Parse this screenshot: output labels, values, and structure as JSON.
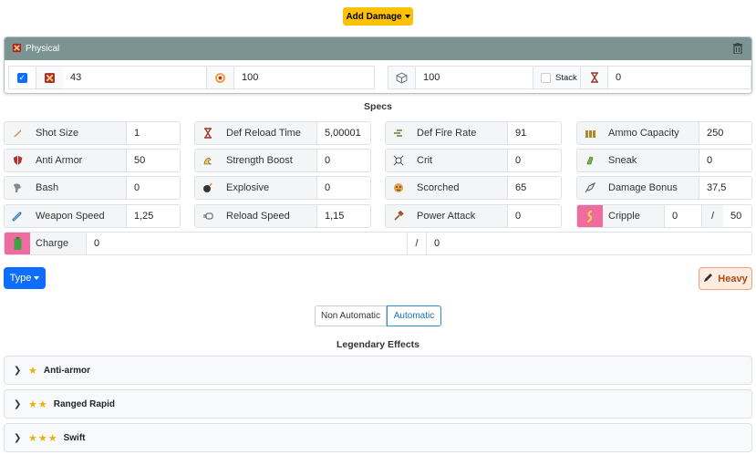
{
  "toolbar": {
    "add_damage_label": "Add Damage"
  },
  "damage_card": {
    "title": "Physical",
    "enabled": true,
    "damage_value": "43",
    "accuracy_value": "100",
    "percent_value": "100",
    "stack_label": "Stack",
    "stack_checked": false,
    "duration_value": "0"
  },
  "specs": {
    "title": "Specs",
    "stats": [
      {
        "label": "Shot Size",
        "value": "1",
        "icon": "bullet-icon"
      },
      {
        "label": "Def Reload Time",
        "value": "5,00001",
        "icon": "hourglass-icon"
      },
      {
        "label": "Def Fire Rate",
        "value": "91",
        "icon": "fire-rate-icon"
      },
      {
        "label": "Ammo Capacity",
        "value": "250",
        "icon": "ammo-icon"
      },
      {
        "label": "Anti Armor",
        "value": "50",
        "icon": "shield-icon"
      },
      {
        "label": "Strength Boost",
        "value": "0",
        "icon": "flex-arm-icon"
      },
      {
        "label": "Crit",
        "value": "0",
        "icon": "crit-icon"
      },
      {
        "label": "Sneak",
        "value": "0",
        "icon": "sneak-icon"
      },
      {
        "label": "Bash",
        "value": "0",
        "icon": "bash-icon"
      },
      {
        "label": "Explosive",
        "value": "0",
        "icon": "bomb-icon"
      },
      {
        "label": "Scorched",
        "value": "65",
        "icon": "scorched-icon"
      },
      {
        "label": "Damage Bonus",
        "value": "37,5",
        "icon": "rocket-icon"
      },
      {
        "label": "Weapon Speed",
        "value": "1,25",
        "icon": "speed-icon"
      },
      {
        "label": "Reload Speed",
        "value": "1,15",
        "icon": "reload-icon"
      },
      {
        "label": "Power Attack",
        "value": "0",
        "icon": "power-attack-icon"
      }
    ],
    "cripple": {
      "label": "Cripple",
      "value": "0",
      "max": "50",
      "icon": "cripple-icon"
    },
    "charge": {
      "label": "Charge",
      "value": "0",
      "max": "0",
      "icon": "battery-icon"
    },
    "slash": "/"
  },
  "type_button": {
    "label": "Type"
  },
  "heavy_button": {
    "label": "Heavy"
  },
  "fire_mode": {
    "options": [
      "Non Automatic",
      "Automatic"
    ],
    "selected": "Automatic"
  },
  "legendary": {
    "title": "Legendary Effects",
    "items": [
      {
        "name": "Anti-armor",
        "stars": 1
      },
      {
        "name": "Ranged Rapid",
        "stars": 2
      },
      {
        "name": "Swift",
        "stars": 3
      }
    ]
  },
  "colors": {
    "accent_blue": "#0d6efd",
    "warning_yellow": "#ffc107",
    "header_gray": "#7c9393",
    "pink": "#f06ba0"
  }
}
